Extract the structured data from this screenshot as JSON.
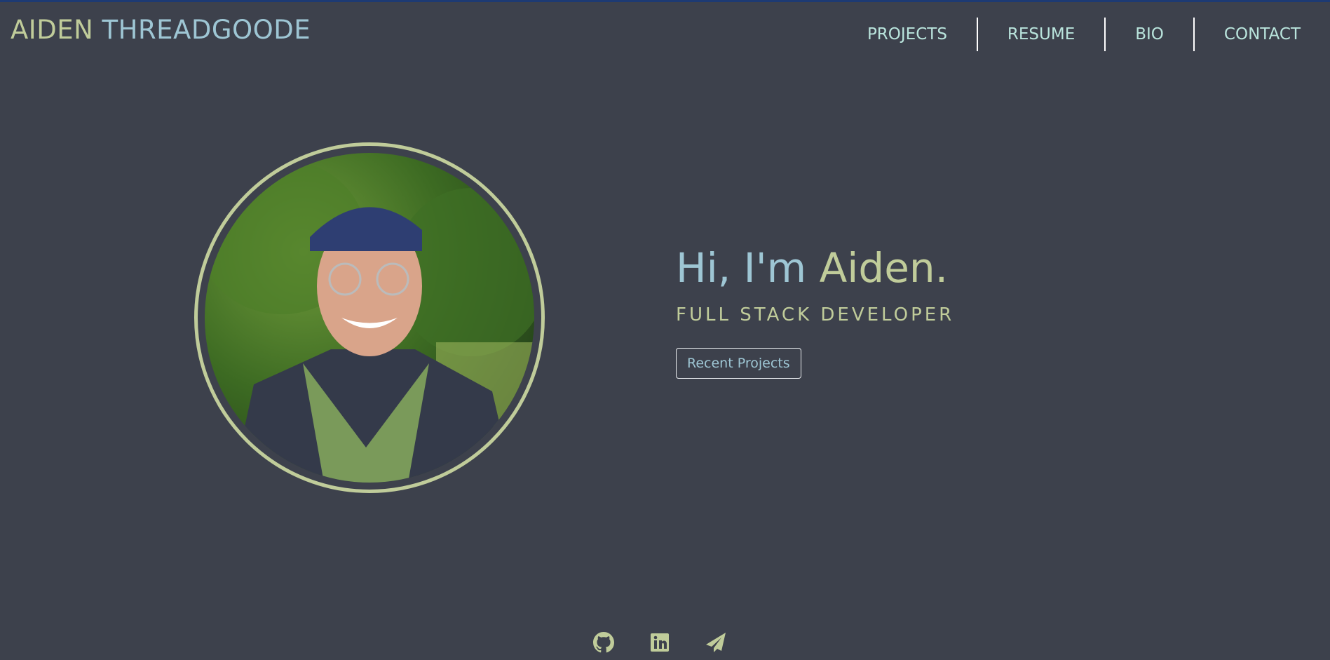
{
  "header": {
    "brand_first": "AIDEN",
    "brand_last": "THREADGOODE",
    "nav": [
      {
        "label": "PROJECTS"
      },
      {
        "label": "RESUME"
      },
      {
        "label": "BIO"
      },
      {
        "label": "CONTACT"
      }
    ]
  },
  "hero": {
    "greeting": "Hi, I'm",
    "name": "Aiden.",
    "subtitle": "FULL STACK DEVELOPER",
    "button": "Recent Projects"
  },
  "social": [
    "github-icon",
    "linkedin-icon",
    "paper-plane-icon"
  ],
  "colors": {
    "background": "#3d414c",
    "green": "#c0cc9a",
    "blue": "#9ec6d4",
    "nav": "#b9e4dc"
  }
}
